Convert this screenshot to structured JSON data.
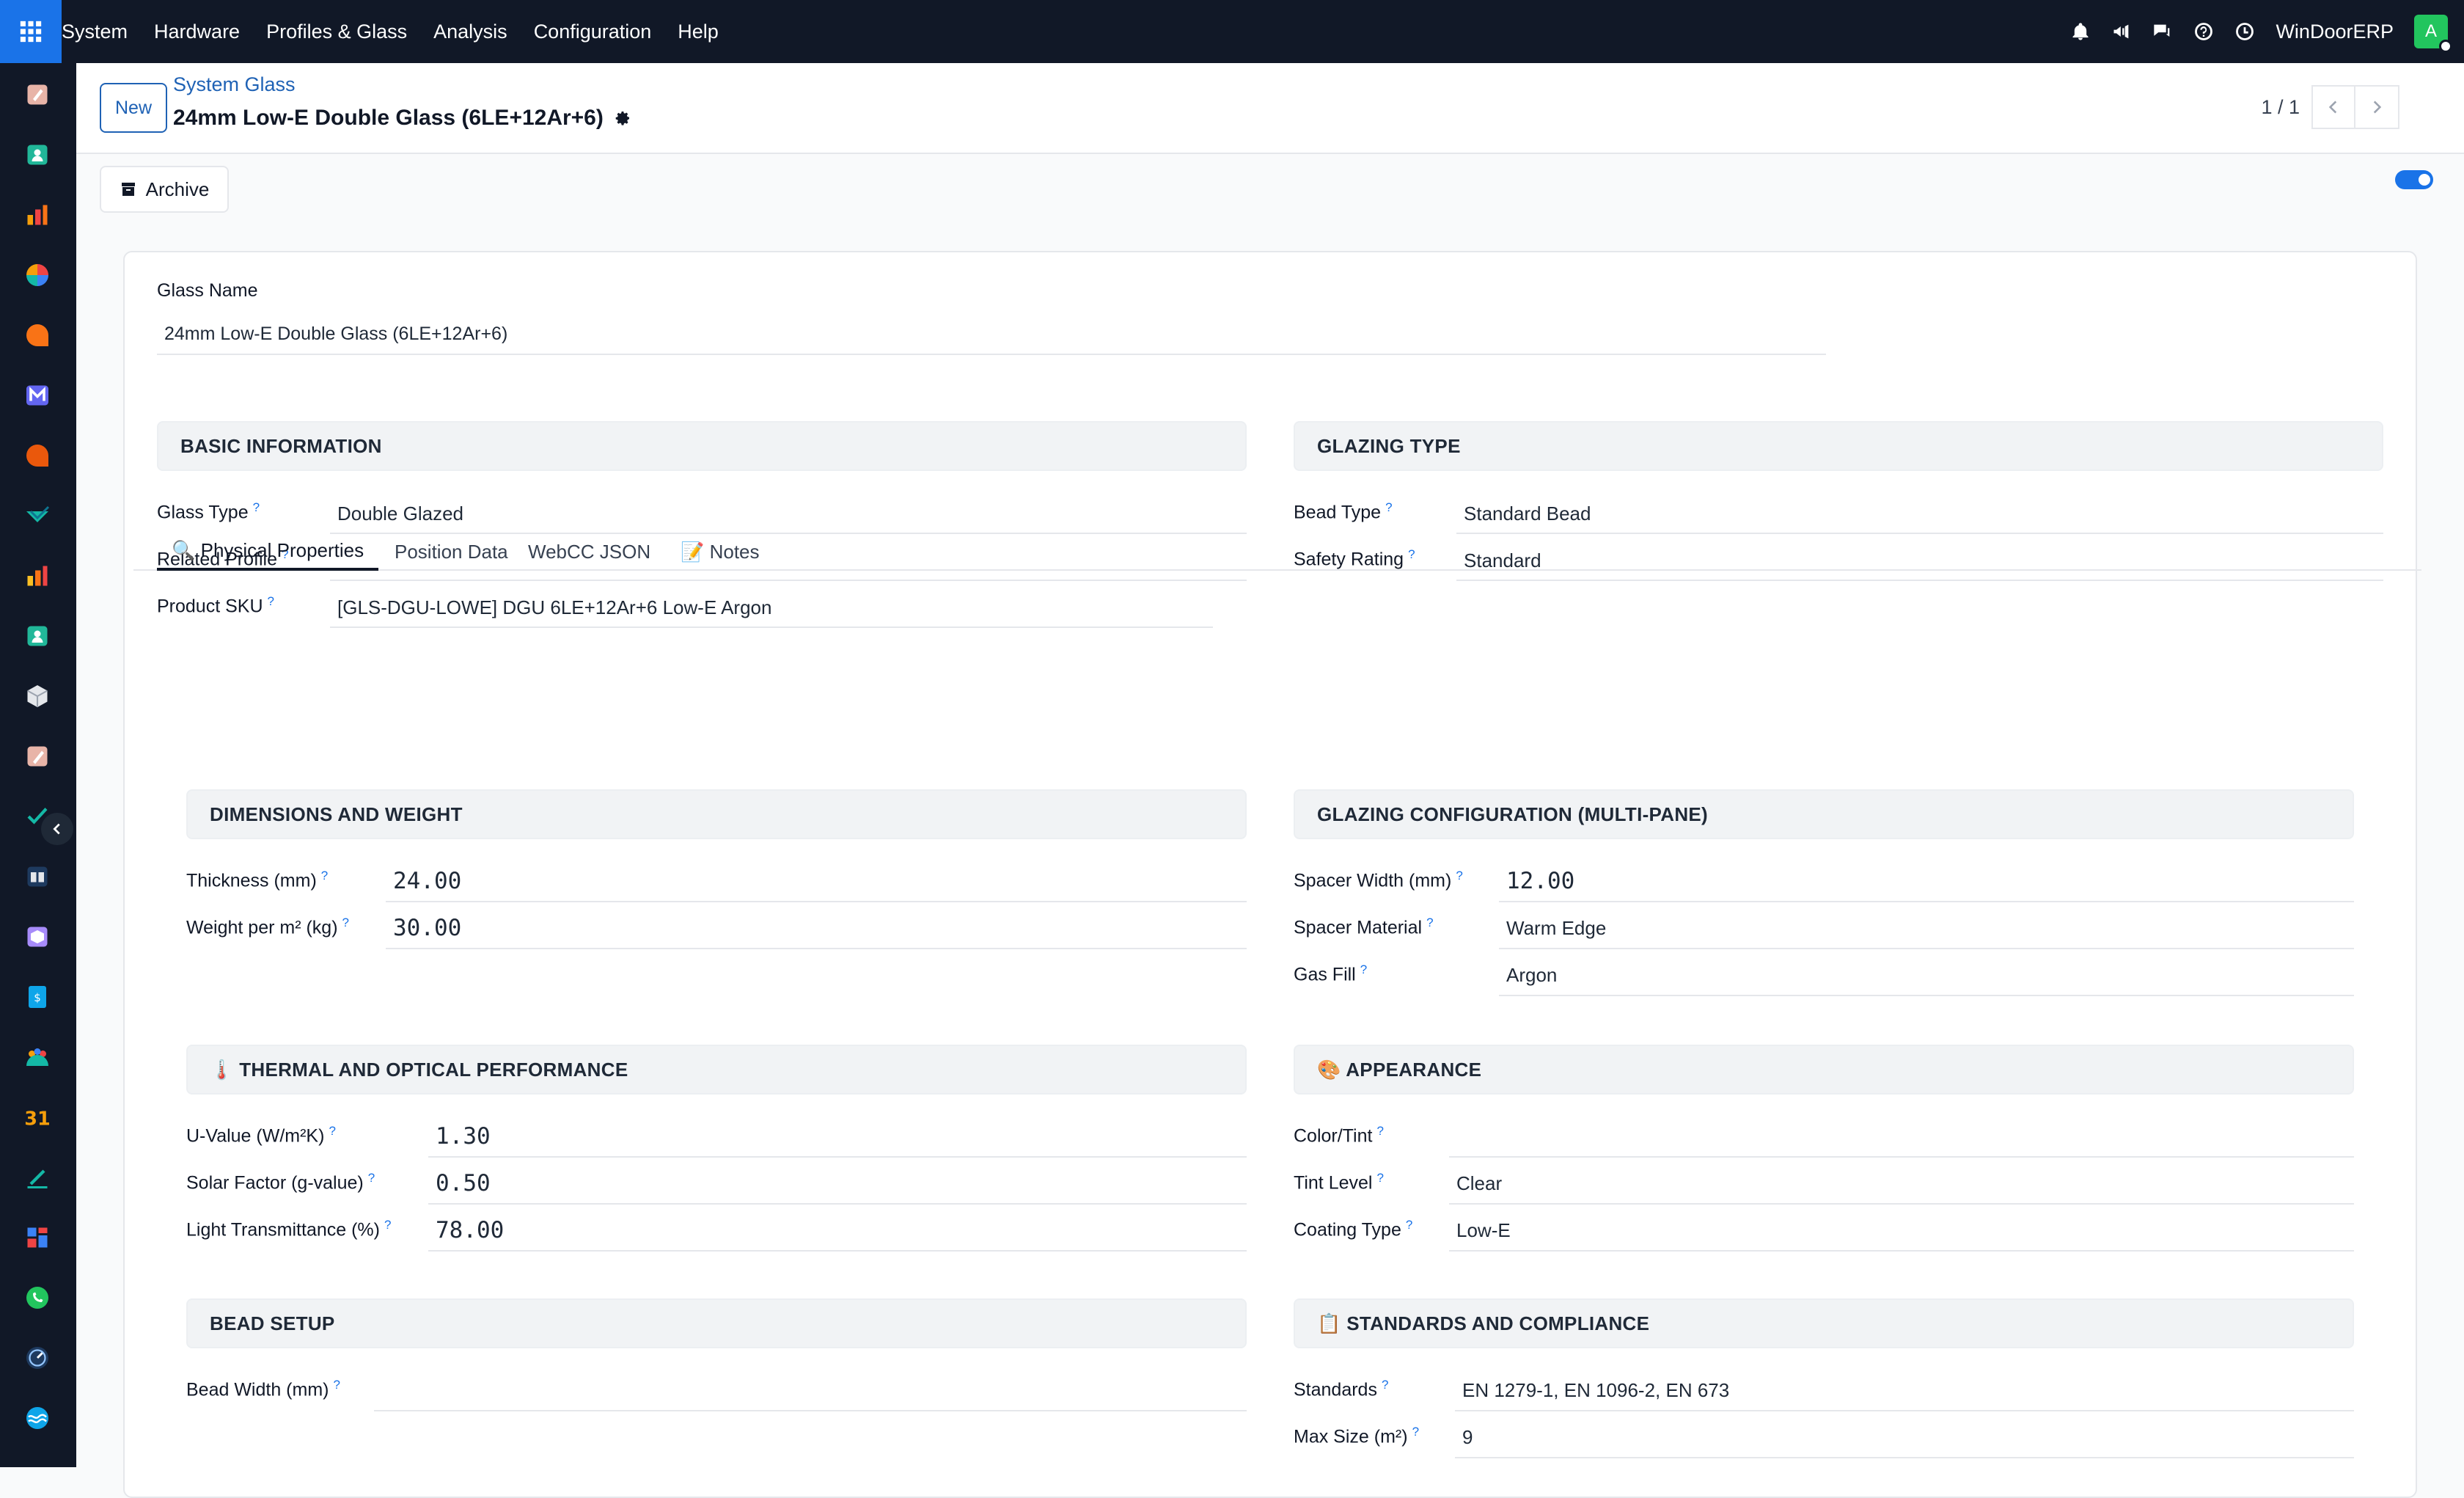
{
  "topbar": {
    "menu": [
      "System",
      "Hardware",
      "Profiles & Glass",
      "Analysis",
      "Configuration",
      "Help"
    ],
    "company": "WinDoorERP",
    "avatar_initial": "A",
    "icons": [
      "bell-icon",
      "megaphone-icon",
      "chat-icon",
      "help-icon",
      "clock-icon"
    ]
  },
  "sidebar": {
    "items": [
      "app-icon-1",
      "app-icon-contacts",
      "app-icon-chart",
      "app-icon-pie",
      "app-icon-chat",
      "app-icon-mail",
      "app-icon-discuss",
      "app-icon-check",
      "app-icon-reports",
      "app-icon-people",
      "app-icon-cube",
      "app-icon-palette",
      "app-icon-tasks",
      "app-icon-book",
      "app-icon-box",
      "app-icon-invoice",
      "app-icon-team",
      "app-icon-calendar",
      "app-icon-sign",
      "app-icon-dashboard",
      "app-icon-whatsapp",
      "app-icon-timer",
      "app-icon-wave"
    ],
    "calendar_text": "31"
  },
  "control_panel": {
    "new_label": "New",
    "breadcrumb": "System Glass",
    "title": "24mm Low-E Double Glass (6LE+12Ar+6)",
    "pager": "1 / 1"
  },
  "actions": {
    "archive_label": "Archive"
  },
  "form": {
    "glass_name_label": "Glass Name",
    "glass_name_value": "24mm Low-E Double Glass (6LE+12Ar+6)",
    "basic_info": {
      "header": "BASIC INFORMATION",
      "glass_type_label": "Glass Type",
      "glass_type_value": "Double Glazed",
      "related_profile_label": "Related Profile",
      "related_profile_value": "",
      "product_sku_label": "Product SKU",
      "product_sku_value": "[GLS-DGU-LOWE] DGU 6LE+12Ar+6 Low-E Argon"
    },
    "glazing_type": {
      "header": "GLAZING TYPE",
      "bead_type_label": "Bead Type",
      "bead_type_value": "Standard Bead",
      "safety_rating_label": "Safety Rating",
      "safety_rating_value": "Standard"
    },
    "tabs": [
      "🔍 Physical Properties",
      "Position Data",
      "WebCC JSON",
      "📝 Notes"
    ],
    "dimensions": {
      "header": "DIMENSIONS AND WEIGHT",
      "thickness_label": "Thickness (mm)",
      "thickness_value": "24.00",
      "weight_label": "Weight per m² (kg)",
      "weight_value": "30.00"
    },
    "glazing_config": {
      "header": "GLAZING CONFIGURATION (MULTI-PANE)",
      "spacer_width_label": "Spacer Width (mm)",
      "spacer_width_value": "12.00",
      "spacer_material_label": "Spacer Material",
      "spacer_material_value": "Warm Edge",
      "gas_fill_label": "Gas Fill",
      "gas_fill_value": "Argon"
    },
    "thermal": {
      "header": "🌡️ THERMAL AND OPTICAL PERFORMANCE",
      "u_value_label": "U-Value (W/m²K)",
      "u_value_value": "1.30",
      "solar_label": "Solar Factor (g-value)",
      "solar_value": "0.50",
      "light_label": "Light Transmittance (%)",
      "light_value": "78.00"
    },
    "appearance": {
      "header": "🎨 APPEARANCE",
      "color_label": "Color/Tint",
      "color_value": "",
      "tint_label": "Tint Level",
      "tint_value": "Clear",
      "coating_label": "Coating Type",
      "coating_value": "Low-E"
    },
    "bead_setup": {
      "header": "BEAD SETUP",
      "bead_width_label": "Bead Width (mm)",
      "bead_width_value": ""
    },
    "standards": {
      "header": "📋 STANDARDS AND COMPLIANCE",
      "standards_label": "Standards",
      "standards_value": "EN 1279-1, EN 1096-2, EN 673",
      "max_size_label": "Max Size (m²)",
      "max_size_value": "9"
    }
  }
}
